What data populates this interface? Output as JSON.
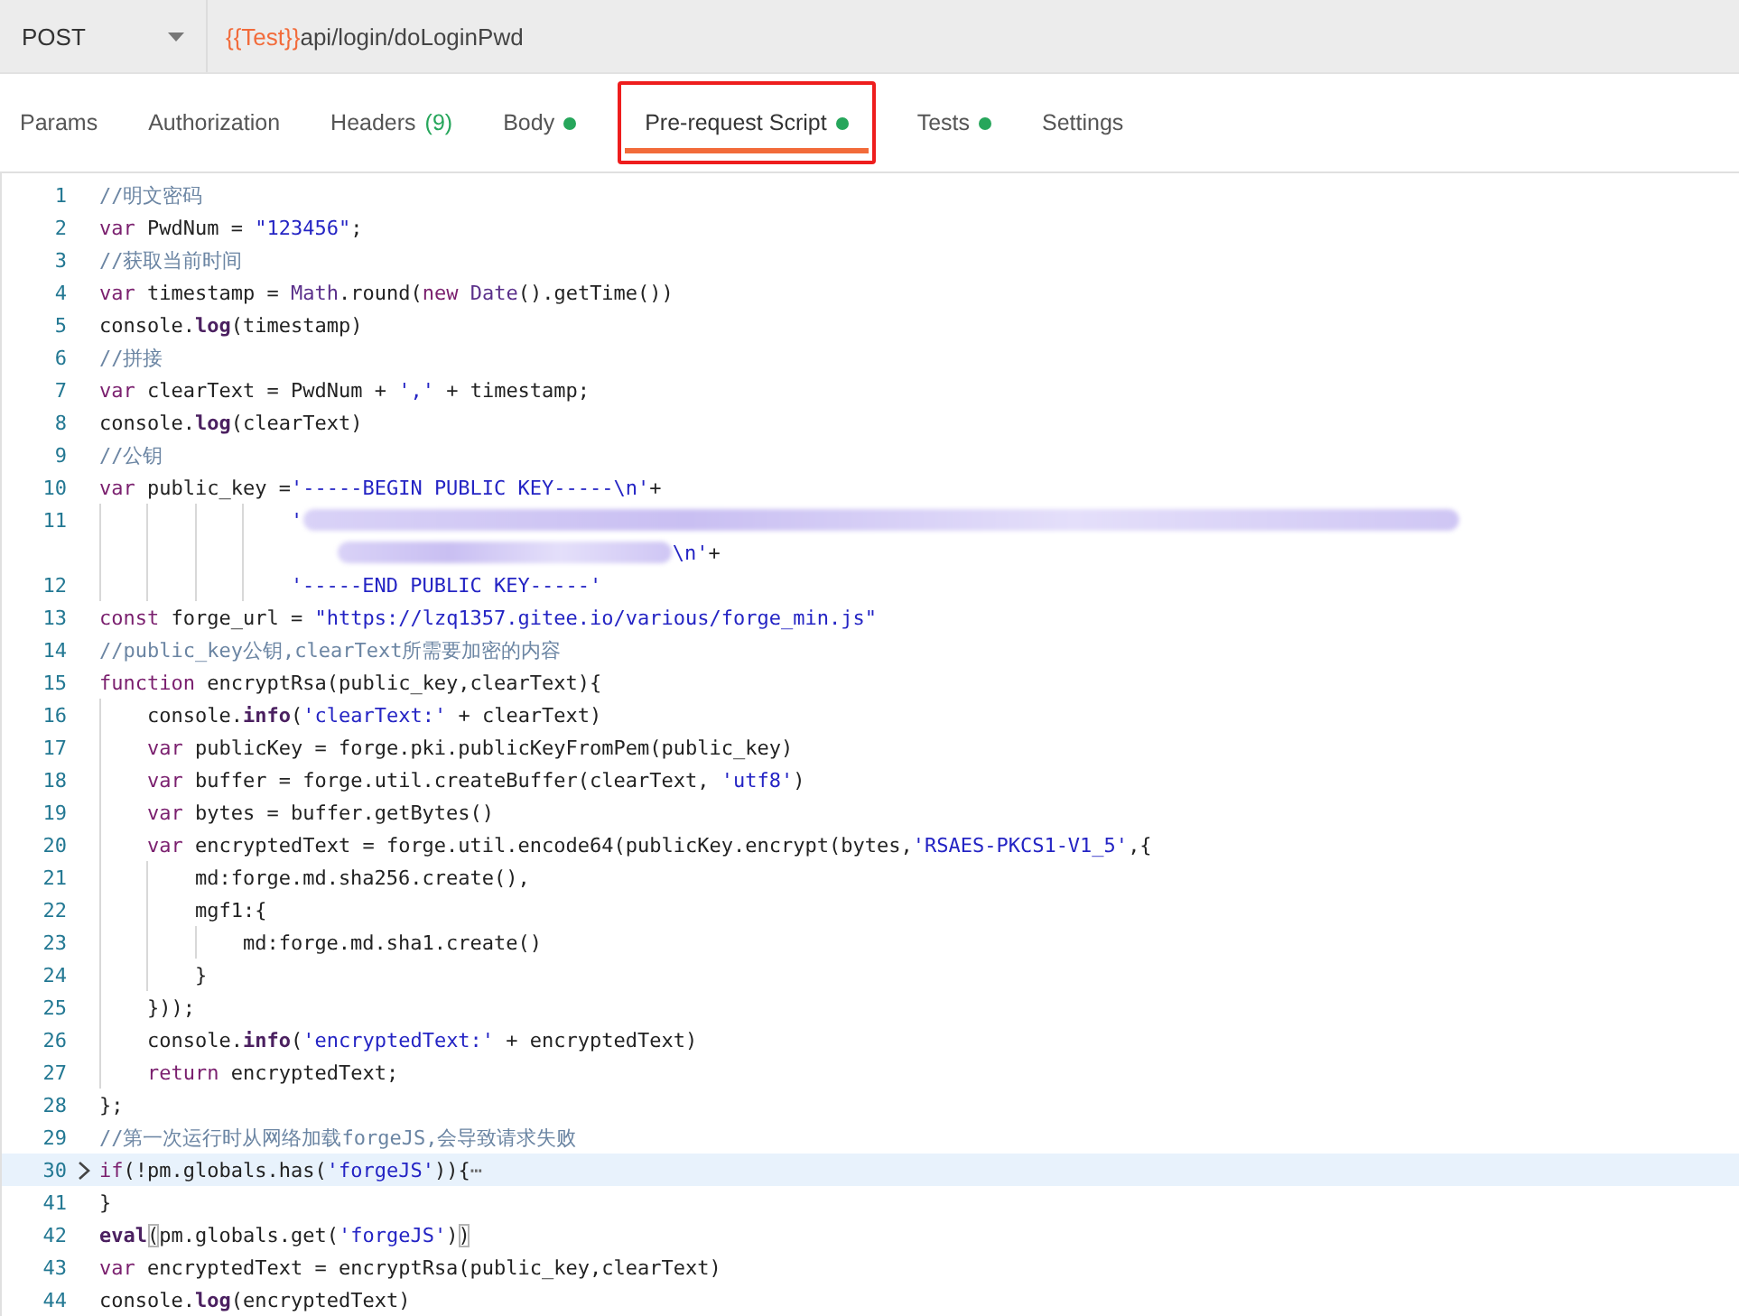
{
  "request": {
    "method": "POST",
    "url": [
      {
        "kind": "variable",
        "text": "{{Test}}"
      },
      {
        "kind": "path",
        "text": "api/login/doLoginPwd"
      }
    ]
  },
  "tabs": [
    {
      "label": "Params",
      "selected": false
    },
    {
      "label": "Authorization",
      "selected": false
    },
    {
      "label": "Headers",
      "count": "(9)",
      "selected": false
    },
    {
      "label": "Body",
      "dot": true,
      "selected": false
    },
    {
      "label": "Pre-request Script",
      "dot": true,
      "selected": true,
      "annotated": true
    },
    {
      "label": "Tests",
      "dot": true,
      "selected": false
    },
    {
      "label": "Settings",
      "selected": false
    }
  ],
  "editor": {
    "lines": [
      {
        "number": "1",
        "tokens": [
          {
            "kind": "comment",
            "text": "//明文密码"
          }
        ]
      },
      {
        "number": "2",
        "tokens": [
          {
            "kind": "keyword",
            "text": "var"
          },
          {
            "kind": "plain",
            "text": " PwdNum = "
          },
          {
            "kind": "string",
            "text": "\"123456\""
          },
          {
            "kind": "plain",
            "text": ";"
          }
        ]
      },
      {
        "number": "3",
        "tokens": [
          {
            "kind": "comment",
            "text": "//获取当前时间"
          }
        ]
      },
      {
        "number": "4",
        "tokens": [
          {
            "kind": "keyword",
            "text": "var"
          },
          {
            "kind": "plain",
            "text": " timestamp = "
          },
          {
            "kind": "builtin",
            "text": "Math"
          },
          {
            "kind": "plain",
            "text": ".round("
          },
          {
            "kind": "keyword",
            "text": "new"
          },
          {
            "kind": "builtin",
            "text": " Date"
          },
          {
            "kind": "plain",
            "text": "().getTime())"
          }
        ]
      },
      {
        "number": "5",
        "tokens": [
          {
            "kind": "plain",
            "text": "console."
          },
          {
            "kind": "method",
            "text": "log"
          },
          {
            "kind": "plain",
            "text": "(timestamp)"
          }
        ]
      },
      {
        "number": "6",
        "tokens": [
          {
            "kind": "comment",
            "text": "//拼接"
          }
        ]
      },
      {
        "number": "7",
        "tokens": [
          {
            "kind": "keyword",
            "text": "var"
          },
          {
            "kind": "plain",
            "text": " clearText = PwdNum + "
          },
          {
            "kind": "string",
            "text": "','"
          },
          {
            "kind": "plain",
            "text": " + timestamp;"
          }
        ]
      },
      {
        "number": "8",
        "tokens": [
          {
            "kind": "plain",
            "text": "console."
          },
          {
            "kind": "method",
            "text": "log"
          },
          {
            "kind": "plain",
            "text": "(clearText)"
          }
        ]
      },
      {
        "number": "9",
        "tokens": [
          {
            "kind": "comment",
            "text": "//公钥"
          }
        ]
      },
      {
        "number": "10",
        "tokens": [
          {
            "kind": "keyword",
            "text": "var"
          },
          {
            "kind": "plain",
            "text": " public_key ="
          },
          {
            "kind": "string",
            "text": "'-----BEGIN PUBLIC KEY-----\\n'"
          },
          {
            "kind": "plain",
            "text": "+"
          }
        ],
        "children": [
          {
            "number": "11",
            "kind": "aligned",
            "tokens": [
              {
                "kind": "string",
                "text": "'"
              },
              {
                "kind": "redaction"
              }
            ],
            "continuation": [
              {
                "kind": "redaction"
              },
              {
                "kind": "string",
                "text": "\\n'"
              },
              {
                "kind": "plain",
                "text": "+"
              }
            ]
          },
          {
            "number": "12",
            "kind": "aligned",
            "tokens": [
              {
                "kind": "string",
                "text": "'-----END PUBLIC KEY-----'"
              }
            ]
          }
        ]
      },
      {
        "number": "13",
        "tokens": [
          {
            "kind": "keyword",
            "text": "const"
          },
          {
            "kind": "plain",
            "text": " forge_url = "
          },
          {
            "kind": "string",
            "text": "\"https://lzq1357.gitee.io/various/forge_min.js\""
          }
        ]
      },
      {
        "number": "14",
        "tokens": [
          {
            "kind": "comment",
            "text": "//public_key公钥,clearText所需要加密的内容"
          }
        ]
      },
      {
        "number": "15",
        "tokens": [
          {
            "kind": "keyword",
            "text": "function"
          },
          {
            "kind": "plain",
            "text": " encryptRsa(public_key,clearText){"
          }
        ],
        "children": [
          {
            "number": "16",
            "tokens": [
              {
                "kind": "plain",
                "text": "console."
              },
              {
                "kind": "method",
                "text": "info"
              },
              {
                "kind": "plain",
                "text": "("
              },
              {
                "kind": "string",
                "text": "'clearText:'"
              },
              {
                "kind": "plain",
                "text": " + clearText)"
              }
            ]
          },
          {
            "number": "17",
            "tokens": [
              {
                "kind": "keyword",
                "text": "var"
              },
              {
                "kind": "plain",
                "text": " publicKey = forge.pki.publicKeyFromPem(public_key)"
              }
            ]
          },
          {
            "number": "18",
            "tokens": [
              {
                "kind": "keyword",
                "text": "var"
              },
              {
                "kind": "plain",
                "text": " buffer = forge.util.createBuffer(clearText, "
              },
              {
                "kind": "string",
                "text": "'utf8'"
              },
              {
                "kind": "plain",
                "text": ")"
              }
            ]
          },
          {
            "number": "19",
            "tokens": [
              {
                "kind": "keyword",
                "text": "var"
              },
              {
                "kind": "plain",
                "text": " bytes = buffer.getBytes()"
              }
            ]
          },
          {
            "number": "20",
            "tokens": [
              {
                "kind": "keyword",
                "text": "var"
              },
              {
                "kind": "plain",
                "text": " encryptedText = forge.util.encode64(publicKey.encrypt(bytes,"
              },
              {
                "kind": "string",
                "text": "'RSAES-PKCS1-V1_5'"
              },
              {
                "kind": "plain",
                "text": ",{"
              }
            ],
            "children": [
              {
                "number": "21",
                "tokens": [
                  {
                    "kind": "plain",
                    "text": "md:forge.md.sha256.create(),"
                  }
                ]
              },
              {
                "number": "22",
                "tokens": [
                  {
                    "kind": "plain",
                    "text": "mgf1:{"
                  }
                ],
                "children": [
                  {
                    "number": "23",
                    "tokens": [
                      {
                        "kind": "plain",
                        "text": "md:forge.md.sha1.create()"
                      }
                    ]
                  }
                ]
              },
              {
                "number": "24",
                "tokens": [
                  {
                    "kind": "plain",
                    "text": "}"
                  }
                ]
              }
            ]
          },
          {
            "number": "25",
            "tokens": [
              {
                "kind": "plain",
                "text": "}));"
              }
            ]
          },
          {
            "number": "26",
            "tokens": [
              {
                "kind": "plain",
                "text": "console."
              },
              {
                "kind": "method",
                "text": "info"
              },
              {
                "kind": "plain",
                "text": "("
              },
              {
                "kind": "string",
                "text": "'encryptedText:'"
              },
              {
                "kind": "plain",
                "text": " + encryptedText)"
              }
            ]
          },
          {
            "number": "27",
            "tokens": [
              {
                "kind": "keyword",
                "text": "return"
              },
              {
                "kind": "plain",
                "text": " encryptedText;"
              }
            ]
          }
        ]
      },
      {
        "number": "28",
        "tokens": [
          {
            "kind": "plain",
            "text": "};"
          }
        ]
      },
      {
        "number": "29",
        "tokens": [
          {
            "kind": "comment",
            "text": "//第一次运行时从网络加载forgeJS,会导致请求失败"
          }
        ]
      },
      {
        "number": "30",
        "folded": true,
        "tokens": [
          {
            "kind": "keyword",
            "text": "if"
          },
          {
            "kind": "plain",
            "text": "(!pm.globals.has("
          },
          {
            "kind": "string",
            "text": "'forgeJS'"
          },
          {
            "kind": "plain",
            "text": ")){"
          },
          {
            "kind": "fold",
            "text": "⋯"
          }
        ]
      },
      {
        "number": "41",
        "tokens": [
          {
            "kind": "plain",
            "text": "}"
          }
        ]
      },
      {
        "number": "42",
        "tokens": [
          {
            "kind": "method",
            "text": "eval"
          },
          {
            "kind": "bracket",
            "text": "("
          },
          {
            "kind": "plain",
            "text": "pm.globals.get("
          },
          {
            "kind": "string",
            "text": "'forgeJS'"
          },
          {
            "kind": "plain",
            "text": ")"
          },
          {
            "kind": "bracket",
            "text": ")"
          }
        ]
      },
      {
        "number": "43",
        "tokens": [
          {
            "kind": "keyword",
            "text": "var"
          },
          {
            "kind": "plain",
            "text": " encryptedText = encryptRsa(public_key,clearText)"
          }
        ]
      },
      {
        "number": "44",
        "tokens": [
          {
            "kind": "plain",
            "text": "console."
          },
          {
            "kind": "method",
            "text": "log"
          },
          {
            "kind": "plain",
            "text": "(encryptedText)"
          }
        ]
      }
    ]
  }
}
